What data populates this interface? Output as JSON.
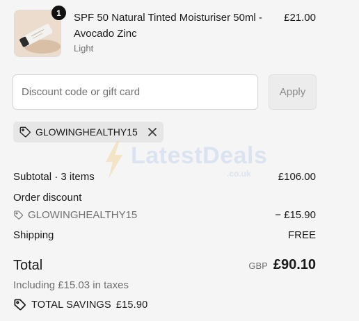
{
  "product": {
    "quantity": "1",
    "name": "SPF 50 Natural Tinted Moisturiser 50ml - Avocado Zinc",
    "variant": "Light",
    "price": "£21.00"
  },
  "discount_form": {
    "placeholder": "Discount code or gift card",
    "apply_label": "Apply"
  },
  "applied_code": {
    "code": "GLOWINGHEALTHY15",
    "icon": "tag-icon",
    "remove_icon": "close-icon"
  },
  "watermark": {
    "text": "LatestDeals",
    "subtext": ".co.uk"
  },
  "summary": {
    "subtotal_label": "Subtotal · 3 items",
    "subtotal_value": "£106.00",
    "order_discount_label": "Order discount",
    "discount_code": "GLOWINGHEALTHY15",
    "discount_value": "− £15.90",
    "shipping_label": "Shipping",
    "shipping_value": "FREE",
    "total_label": "Total",
    "currency": "GBP",
    "total_value": "£90.10",
    "tax_note": "Including £15.03 in taxes",
    "savings_label": "TOTAL SAVINGS",
    "savings_value": "£15.90"
  },
  "colors": {
    "background": "#f5f5f5",
    "text": "#1a1a1a",
    "muted": "#707070"
  }
}
